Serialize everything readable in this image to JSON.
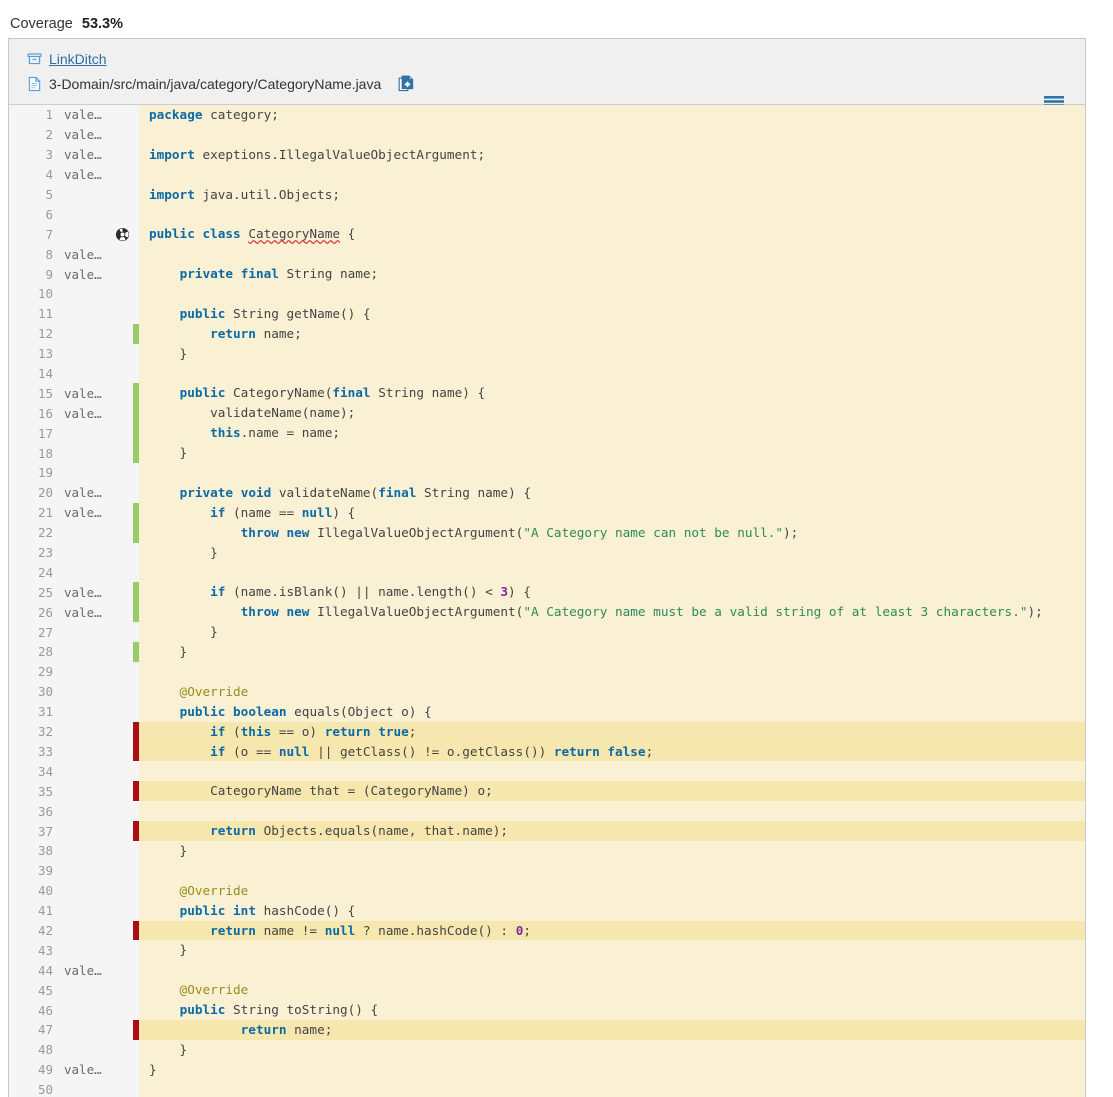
{
  "header": {
    "coverage_label": "Coverage",
    "coverage_value": "53.3%"
  },
  "panel": {
    "project_name": "LinkDitch",
    "file_path": "3-Domain/src/main/java/category/CategoryName.java",
    "project_icon": "archive-box-icon",
    "file_icon": "file-icon",
    "copy_icon": "copy-file-icon",
    "menu_icon": "hamburger-menu-icon",
    "class_marker_icon": "class-coverage-icon"
  },
  "colors": {
    "covered": "#99cc66",
    "uncovered": "#a90d16",
    "code_bg": "#faf0d4",
    "code_bg_highlight": "#f6e7ae",
    "gutter_bg": "#f5f5f5",
    "link": "#2e6da4",
    "keyword": "#0b6aa5",
    "string": "#2e8b57",
    "number": "#7a29a8",
    "annotation": "#9b8b1a"
  },
  "author_label": "vale…",
  "lines": [
    {
      "n": 1,
      "author": "vale…",
      "cov": "",
      "hl": false,
      "marker": "",
      "tokens": [
        {
          "t": "package",
          "c": "kw"
        },
        {
          "t": " category;",
          "c": "pl"
        }
      ]
    },
    {
      "n": 2,
      "author": "vale…",
      "cov": "",
      "hl": false,
      "marker": "",
      "tokens": []
    },
    {
      "n": 3,
      "author": "vale…",
      "cov": "",
      "hl": false,
      "marker": "",
      "tokens": [
        {
          "t": "import",
          "c": "kw"
        },
        {
          "t": " exeptions.IllegalValueObjectArgument;",
          "c": "pl"
        }
      ]
    },
    {
      "n": 4,
      "author": "vale…",
      "cov": "",
      "hl": false,
      "marker": "",
      "tokens": []
    },
    {
      "n": 5,
      "author": "",
      "cov": "",
      "hl": false,
      "marker": "",
      "tokens": [
        {
          "t": "import",
          "c": "kw"
        },
        {
          "t": " java.util.Objects;",
          "c": "pl"
        }
      ]
    },
    {
      "n": 6,
      "author": "",
      "cov": "",
      "hl": false,
      "marker": "",
      "tokens": []
    },
    {
      "n": 7,
      "author": "",
      "cov": "",
      "hl": false,
      "marker": "class",
      "tokens": [
        {
          "t": "public",
          "c": "kw"
        },
        {
          "t": " ",
          "c": "pl"
        },
        {
          "t": "class",
          "c": "kw"
        },
        {
          "t": " ",
          "c": "pl"
        },
        {
          "t": "CategoryName",
          "c": "squig"
        },
        {
          "t": " {",
          "c": "pl"
        }
      ]
    },
    {
      "n": 8,
      "author": "vale…",
      "cov": "",
      "hl": false,
      "marker": "",
      "tokens": []
    },
    {
      "n": 9,
      "author": "vale…",
      "cov": "",
      "hl": false,
      "marker": "",
      "tokens": [
        {
          "t": "    ",
          "c": "pl"
        },
        {
          "t": "private",
          "c": "kw"
        },
        {
          "t": " ",
          "c": "pl"
        },
        {
          "t": "final",
          "c": "kw"
        },
        {
          "t": " String name;",
          "c": "pl"
        }
      ]
    },
    {
      "n": 10,
      "author": "",
      "cov": "",
      "hl": false,
      "marker": "",
      "tokens": []
    },
    {
      "n": 11,
      "author": "",
      "cov": "",
      "hl": false,
      "marker": "",
      "tokens": [
        {
          "t": "    ",
          "c": "pl"
        },
        {
          "t": "public",
          "c": "kw"
        },
        {
          "t": " String getName() {",
          "c": "pl"
        }
      ]
    },
    {
      "n": 12,
      "author": "",
      "cov": "green",
      "hl": false,
      "marker": "",
      "tokens": [
        {
          "t": "        ",
          "c": "pl"
        },
        {
          "t": "return",
          "c": "kw"
        },
        {
          "t": " name;",
          "c": "pl"
        }
      ]
    },
    {
      "n": 13,
      "author": "",
      "cov": "",
      "hl": false,
      "marker": "",
      "tokens": [
        {
          "t": "    }",
          "c": "pl"
        }
      ]
    },
    {
      "n": 14,
      "author": "",
      "cov": "",
      "hl": false,
      "marker": "",
      "tokens": []
    },
    {
      "n": 15,
      "author": "vale…",
      "cov": "green",
      "hl": false,
      "marker": "",
      "tokens": [
        {
          "t": "    ",
          "c": "pl"
        },
        {
          "t": "public",
          "c": "kw"
        },
        {
          "t": " CategoryName(",
          "c": "pl"
        },
        {
          "t": "final",
          "c": "kw"
        },
        {
          "t": " String name) {",
          "c": "pl"
        }
      ]
    },
    {
      "n": 16,
      "author": "vale…",
      "cov": "green",
      "hl": false,
      "marker": "",
      "tokens": [
        {
          "t": "        validateName(name);",
          "c": "pl"
        }
      ]
    },
    {
      "n": 17,
      "author": "",
      "cov": "green",
      "hl": false,
      "marker": "",
      "tokens": [
        {
          "t": "        ",
          "c": "pl"
        },
        {
          "t": "this",
          "c": "kw"
        },
        {
          "t": ".name = name;",
          "c": "pl"
        }
      ]
    },
    {
      "n": 18,
      "author": "",
      "cov": "green",
      "hl": false,
      "marker": "",
      "tokens": [
        {
          "t": "    }",
          "c": "pl"
        }
      ]
    },
    {
      "n": 19,
      "author": "",
      "cov": "",
      "hl": false,
      "marker": "",
      "tokens": []
    },
    {
      "n": 20,
      "author": "vale…",
      "cov": "",
      "hl": false,
      "marker": "",
      "tokens": [
        {
          "t": "    ",
          "c": "pl"
        },
        {
          "t": "private",
          "c": "kw"
        },
        {
          "t": " ",
          "c": "pl"
        },
        {
          "t": "void",
          "c": "kw"
        },
        {
          "t": " validateName(",
          "c": "pl"
        },
        {
          "t": "final",
          "c": "kw"
        },
        {
          "t": " String name) {",
          "c": "pl"
        }
      ]
    },
    {
      "n": 21,
      "author": "vale…",
      "cov": "green",
      "hl": false,
      "marker": "",
      "tokens": [
        {
          "t": "        ",
          "c": "pl"
        },
        {
          "t": "if",
          "c": "kw"
        },
        {
          "t": " (name == ",
          "c": "pl"
        },
        {
          "t": "null",
          "c": "kw"
        },
        {
          "t": ") {",
          "c": "pl"
        }
      ]
    },
    {
      "n": 22,
      "author": "",
      "cov": "green",
      "hl": false,
      "marker": "",
      "tokens": [
        {
          "t": "            ",
          "c": "pl"
        },
        {
          "t": "throw",
          "c": "kw"
        },
        {
          "t": " ",
          "c": "pl"
        },
        {
          "t": "new",
          "c": "kw"
        },
        {
          "t": " IllegalValueObjectArgument(",
          "c": "pl"
        },
        {
          "t": "\"A Category name can not be null.\"",
          "c": "str"
        },
        {
          "t": ");",
          "c": "pl"
        }
      ]
    },
    {
      "n": 23,
      "author": "",
      "cov": "",
      "hl": false,
      "marker": "",
      "tokens": [
        {
          "t": "        }",
          "c": "pl"
        }
      ]
    },
    {
      "n": 24,
      "author": "",
      "cov": "",
      "hl": false,
      "marker": "",
      "tokens": []
    },
    {
      "n": 25,
      "author": "vale…",
      "cov": "green",
      "hl": false,
      "marker": "",
      "tokens": [
        {
          "t": "        ",
          "c": "pl"
        },
        {
          "t": "if",
          "c": "kw"
        },
        {
          "t": " (name.isBlank() || name.length() < ",
          "c": "pl"
        },
        {
          "t": "3",
          "c": "num"
        },
        {
          "t": ") {",
          "c": "pl"
        }
      ]
    },
    {
      "n": 26,
      "author": "vale…",
      "cov": "green",
      "hl": false,
      "marker": "",
      "tokens": [
        {
          "t": "            ",
          "c": "pl"
        },
        {
          "t": "throw",
          "c": "kw"
        },
        {
          "t": " ",
          "c": "pl"
        },
        {
          "t": "new",
          "c": "kw"
        },
        {
          "t": " IllegalValueObjectArgument(",
          "c": "pl"
        },
        {
          "t": "\"A Category name must be a valid string of at least 3 characters.\"",
          "c": "str"
        },
        {
          "t": ");",
          "c": "pl"
        }
      ]
    },
    {
      "n": 27,
      "author": "",
      "cov": "",
      "hl": false,
      "marker": "",
      "tokens": [
        {
          "t": "        }",
          "c": "pl"
        }
      ]
    },
    {
      "n": 28,
      "author": "",
      "cov": "green",
      "hl": false,
      "marker": "",
      "tokens": [
        {
          "t": "    }",
          "c": "pl"
        }
      ]
    },
    {
      "n": 29,
      "author": "",
      "cov": "",
      "hl": false,
      "marker": "",
      "tokens": []
    },
    {
      "n": 30,
      "author": "",
      "cov": "",
      "hl": false,
      "marker": "",
      "tokens": [
        {
          "t": "    @Override",
          "c": "ann"
        }
      ]
    },
    {
      "n": 31,
      "author": "",
      "cov": "",
      "hl": false,
      "marker": "",
      "tokens": [
        {
          "t": "    ",
          "c": "pl"
        },
        {
          "t": "public",
          "c": "kw"
        },
        {
          "t": " ",
          "c": "pl"
        },
        {
          "t": "boolean",
          "c": "kw"
        },
        {
          "t": " equals(Object o) {",
          "c": "pl"
        }
      ]
    },
    {
      "n": 32,
      "author": "",
      "cov": "red",
      "hl": true,
      "marker": "",
      "tokens": [
        {
          "t": "        ",
          "c": "pl"
        },
        {
          "t": "if",
          "c": "kw"
        },
        {
          "t": " (",
          "c": "pl"
        },
        {
          "t": "this",
          "c": "kw"
        },
        {
          "t": " == o) ",
          "c": "pl"
        },
        {
          "t": "return",
          "c": "kw"
        },
        {
          "t": " ",
          "c": "pl"
        },
        {
          "t": "true",
          "c": "kw"
        },
        {
          "t": ";",
          "c": "pl"
        }
      ]
    },
    {
      "n": 33,
      "author": "",
      "cov": "red",
      "hl": true,
      "marker": "",
      "tokens": [
        {
          "t": "        ",
          "c": "pl"
        },
        {
          "t": "if",
          "c": "kw"
        },
        {
          "t": " (o == ",
          "c": "pl"
        },
        {
          "t": "null",
          "c": "kw"
        },
        {
          "t": " || getClass() != o.getClass()) ",
          "c": "pl"
        },
        {
          "t": "return",
          "c": "kw"
        },
        {
          "t": " ",
          "c": "pl"
        },
        {
          "t": "false",
          "c": "kw"
        },
        {
          "t": ";",
          "c": "pl"
        }
      ]
    },
    {
      "n": 34,
      "author": "",
      "cov": "",
      "hl": false,
      "marker": "",
      "tokens": []
    },
    {
      "n": 35,
      "author": "",
      "cov": "red",
      "hl": true,
      "marker": "",
      "tokens": [
        {
          "t": "        CategoryName that = (CategoryName) o;",
          "c": "pl"
        }
      ]
    },
    {
      "n": 36,
      "author": "",
      "cov": "",
      "hl": false,
      "marker": "",
      "tokens": []
    },
    {
      "n": 37,
      "author": "",
      "cov": "red",
      "hl": true,
      "marker": "",
      "tokens": [
        {
          "t": "        ",
          "c": "pl"
        },
        {
          "t": "return",
          "c": "kw"
        },
        {
          "t": " Objects.equals(name, that.name);",
          "c": "pl"
        }
      ]
    },
    {
      "n": 38,
      "author": "",
      "cov": "",
      "hl": false,
      "marker": "",
      "tokens": [
        {
          "t": "    }",
          "c": "pl"
        }
      ]
    },
    {
      "n": 39,
      "author": "",
      "cov": "",
      "hl": false,
      "marker": "",
      "tokens": []
    },
    {
      "n": 40,
      "author": "",
      "cov": "",
      "hl": false,
      "marker": "",
      "tokens": [
        {
          "t": "    @Override",
          "c": "ann"
        }
      ]
    },
    {
      "n": 41,
      "author": "",
      "cov": "",
      "hl": false,
      "marker": "",
      "tokens": [
        {
          "t": "    ",
          "c": "pl"
        },
        {
          "t": "public",
          "c": "kw"
        },
        {
          "t": " ",
          "c": "pl"
        },
        {
          "t": "int",
          "c": "kw"
        },
        {
          "t": " hashCode() {",
          "c": "pl"
        }
      ]
    },
    {
      "n": 42,
      "author": "",
      "cov": "red",
      "hl": true,
      "marker": "",
      "tokens": [
        {
          "t": "        ",
          "c": "pl"
        },
        {
          "t": "return",
          "c": "kw"
        },
        {
          "t": " name != ",
          "c": "pl"
        },
        {
          "t": "null",
          "c": "kw"
        },
        {
          "t": " ? name.hashCode() : ",
          "c": "pl"
        },
        {
          "t": "0",
          "c": "num"
        },
        {
          "t": ";",
          "c": "pl"
        }
      ]
    },
    {
      "n": 43,
      "author": "",
      "cov": "",
      "hl": false,
      "marker": "",
      "tokens": [
        {
          "t": "    }",
          "c": "pl"
        }
      ]
    },
    {
      "n": 44,
      "author": "vale…",
      "cov": "",
      "hl": false,
      "marker": "",
      "tokens": []
    },
    {
      "n": 45,
      "author": "",
      "cov": "",
      "hl": false,
      "marker": "",
      "tokens": [
        {
          "t": "    @Override",
          "c": "ann"
        }
      ]
    },
    {
      "n": 46,
      "author": "",
      "cov": "",
      "hl": false,
      "marker": "",
      "tokens": [
        {
          "t": "    ",
          "c": "pl"
        },
        {
          "t": "public",
          "c": "kw"
        },
        {
          "t": " String toString() {",
          "c": "pl"
        }
      ]
    },
    {
      "n": 47,
      "author": "",
      "cov": "red",
      "hl": true,
      "marker": "",
      "tokens": [
        {
          "t": "            ",
          "c": "pl"
        },
        {
          "t": "return",
          "c": "kw"
        },
        {
          "t": " name;",
          "c": "pl"
        }
      ]
    },
    {
      "n": 48,
      "author": "",
      "cov": "",
      "hl": false,
      "marker": "",
      "tokens": [
        {
          "t": "    }",
          "c": "pl"
        }
      ]
    },
    {
      "n": 49,
      "author": "vale…",
      "cov": "",
      "hl": false,
      "marker": "",
      "tokens": [
        {
          "t": "}",
          "c": "pl"
        }
      ]
    },
    {
      "n": 50,
      "author": "",
      "cov": "",
      "hl": false,
      "marker": "",
      "tokens": []
    }
  ]
}
